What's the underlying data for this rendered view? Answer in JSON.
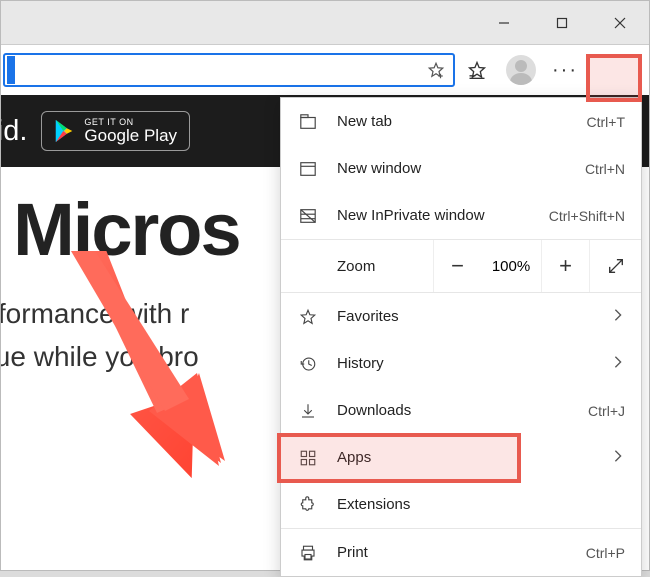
{
  "titlebar": {
    "minimize": "—",
    "maximize": "□",
    "close": "✕"
  },
  "banner": {
    "platform": "roid.",
    "gplay_small": "GET IT ON",
    "gplay_big": "Google Play"
  },
  "page": {
    "headline": "w Micros",
    "subline": "erformance with r\nalue while you bro"
  },
  "menu": {
    "new_tab": {
      "label": "New tab",
      "shortcut": "Ctrl+T"
    },
    "new_window": {
      "label": "New window",
      "shortcut": "Ctrl+N"
    },
    "new_inprivate": {
      "label": "New InPrivate window",
      "shortcut": "Ctrl+Shift+N"
    },
    "zoom": {
      "label": "Zoom",
      "minus": "−",
      "value": "100%",
      "plus": "+"
    },
    "favorites": {
      "label": "Favorites"
    },
    "history": {
      "label": "History"
    },
    "downloads": {
      "label": "Downloads",
      "shortcut": "Ctrl+J"
    },
    "apps": {
      "label": "Apps"
    },
    "extensions": {
      "label": "Extensions"
    },
    "print": {
      "label": "Print",
      "shortcut": "Ctrl+P"
    }
  }
}
